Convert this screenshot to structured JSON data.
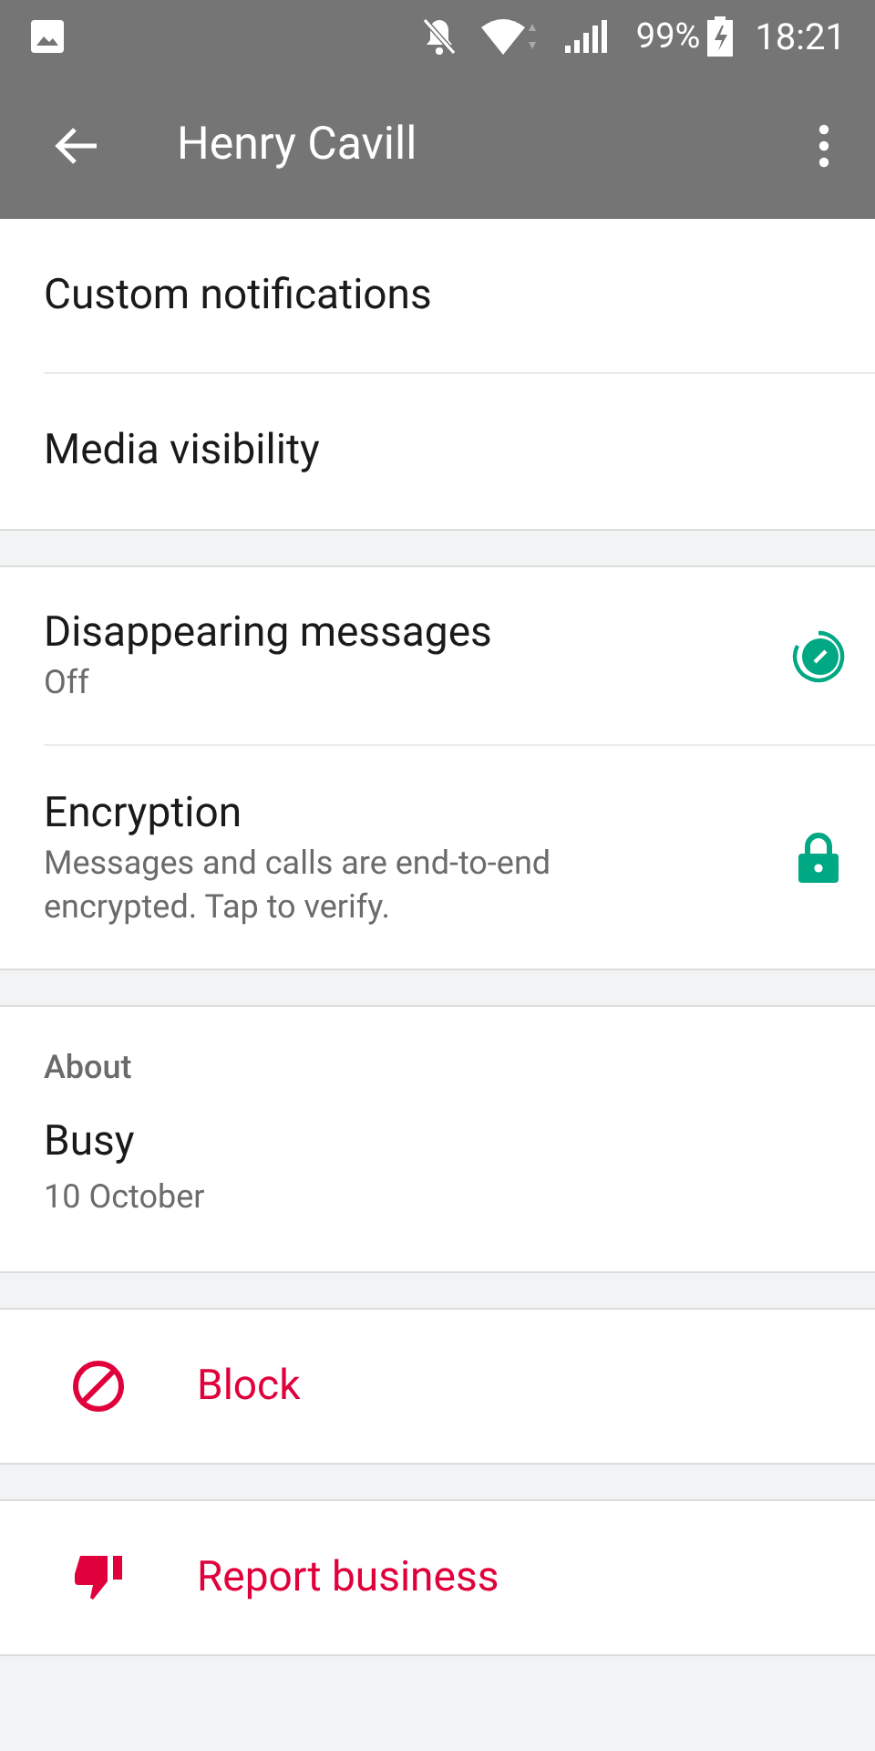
{
  "status_bar": {
    "battery": "99%",
    "time": "18:21"
  },
  "toolbar": {
    "title": "Henry Cavill"
  },
  "media_section": {
    "items": [
      "Custom notifications",
      "Media visibility"
    ]
  },
  "privacy_section": {
    "disappearing_messages": {
      "title": "Disappearing messages",
      "value": "Off"
    },
    "encryption": {
      "title": "Encryption",
      "description": "Messages and calls are end-to-end encrypted. Tap to verify."
    }
  },
  "about_section": {
    "header": "About",
    "text": "Busy",
    "date": "10 October"
  },
  "block": {
    "label": "Block"
  },
  "report": {
    "label": "Report business"
  }
}
